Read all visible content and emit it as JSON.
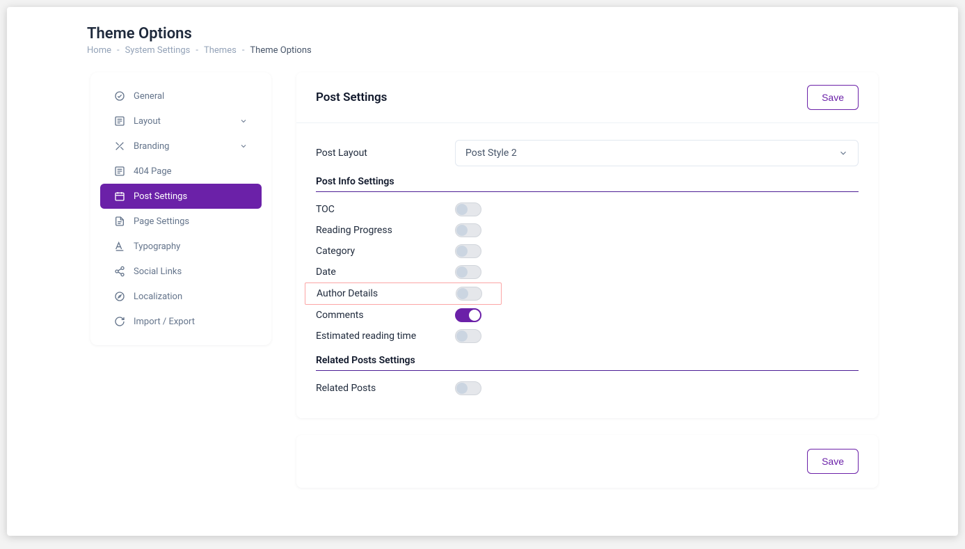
{
  "page_title": "Theme Options",
  "breadcrumb": {
    "items": [
      "Home",
      "System Settings",
      "Themes"
    ],
    "current": "Theme Options"
  },
  "sidebar": {
    "items": [
      {
        "icon": "check-circle",
        "label": "General",
        "expandable": false
      },
      {
        "icon": "layout",
        "label": "Layout",
        "expandable": true
      },
      {
        "icon": "branding",
        "label": "Branding",
        "expandable": true
      },
      {
        "icon": "page-404",
        "label": "404 Page",
        "expandable": false
      },
      {
        "icon": "calendar-post",
        "label": "Post Settings",
        "expandable": false,
        "active": true
      },
      {
        "icon": "file",
        "label": "Page Settings",
        "expandable": false
      },
      {
        "icon": "typography",
        "label": "Typography",
        "expandable": false
      },
      {
        "icon": "share",
        "label": "Social Links",
        "expandable": false
      },
      {
        "icon": "compass",
        "label": "Localization",
        "expandable": false
      },
      {
        "icon": "refresh",
        "label": "Import / Export",
        "expandable": false
      }
    ]
  },
  "card": {
    "title": "Post Settings",
    "save_label": "Save",
    "post_layout_label": "Post Layout",
    "post_layout_value": "Post Style 2",
    "sections": {
      "post_info_title": "Post Info Settings",
      "toggles": [
        {
          "label": "TOC",
          "on": false,
          "highlighted": false
        },
        {
          "label": "Reading Progress",
          "on": false,
          "highlighted": false
        },
        {
          "label": "Category",
          "on": false,
          "highlighted": false
        },
        {
          "label": "Date",
          "on": false,
          "highlighted": false
        },
        {
          "label": "Author Details",
          "on": false,
          "highlighted": true
        },
        {
          "label": "Comments",
          "on": true,
          "highlighted": false
        },
        {
          "label": "Estimated reading time",
          "on": false,
          "highlighted": false
        }
      ],
      "related_title": "Related Posts Settings",
      "related_toggles": [
        {
          "label": "Related Posts",
          "on": false
        }
      ]
    }
  }
}
